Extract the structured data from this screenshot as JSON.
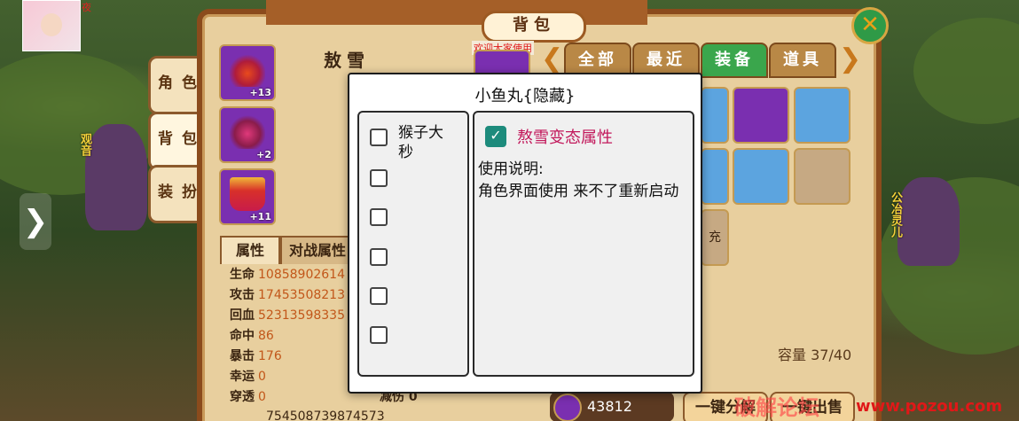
{
  "corner_text": "夜",
  "left_panel": {
    "side_tabs": [
      "角色",
      "背包",
      "装扮"
    ],
    "side_characters": [
      "观音"
    ],
    "right_characters": [
      "公冶灵儿"
    ]
  },
  "backpack": {
    "title": "背包",
    "char_name": "敖雪",
    "welcome": "欢迎大家使用",
    "category_tabs": [
      "全部",
      "最近",
      "装备",
      "道具"
    ],
    "active_category": "装备",
    "equip_slots": [
      {
        "count": "+13",
        "icon": "winged-crown-icon"
      },
      {
        "count": "+2",
        "icon": "armor-icon"
      },
      {
        "count": "+11",
        "icon": "robe-icon"
      }
    ],
    "grid_items": [
      {
        "icon": "blade-icon",
        "tone": "blue"
      },
      {
        "icon": "winged-crown-icon",
        "tone": "purple"
      },
      {
        "icon": "boot-icon",
        "tone": "blue"
      },
      {
        "icon": "staff-icon",
        "tone": "blue"
      },
      {
        "icon": "shoe-icon",
        "tone": "blue"
      },
      {
        "icon": "empty-slot-icon",
        "tone": "empty"
      }
    ],
    "partial_button": "充",
    "capacity": "容量 37/40",
    "stat_tabs": [
      "属性",
      "对战属性"
    ],
    "stats": [
      {
        "label": "生命",
        "value": "10858902614"
      },
      {
        "label": "攻击",
        "value": "17453508213"
      },
      {
        "label": "回血",
        "value": "52313598335"
      },
      {
        "label": "命中",
        "value": "86"
      },
      {
        "label": "暴击",
        "value": "176"
      },
      {
        "label": "幸运",
        "value": "0"
      },
      {
        "label": "穿透",
        "value": "0"
      }
    ],
    "reduce_label": "减伤 0",
    "currency": "43812",
    "bottom_buttons": [
      "一键分解",
      "一键出售"
    ],
    "bottom_name_value": "754508739874573"
  },
  "dialog": {
    "title": "小鱼丸{隐藏}",
    "list_items": [
      {
        "label": "猴子大秒",
        "checked": false
      },
      {
        "label": "",
        "checked": false
      },
      {
        "label": "",
        "checked": false
      },
      {
        "label": "",
        "checked": false
      },
      {
        "label": "",
        "checked": false
      },
      {
        "label": "",
        "checked": false
      }
    ],
    "detail": {
      "title": "熬雪变态属性",
      "checked": true,
      "description": "使用说明:\n角色界面使用 来不了重新启动"
    }
  },
  "watermark": {
    "cn": "破解论坛",
    "url": "www.pozou.com"
  },
  "colors": {
    "panel_bg": "#e8cf9e",
    "active_tab": "#3aa64c",
    "detail_title": "#c2185b",
    "checkbox_checked": "#1d8b7c"
  }
}
